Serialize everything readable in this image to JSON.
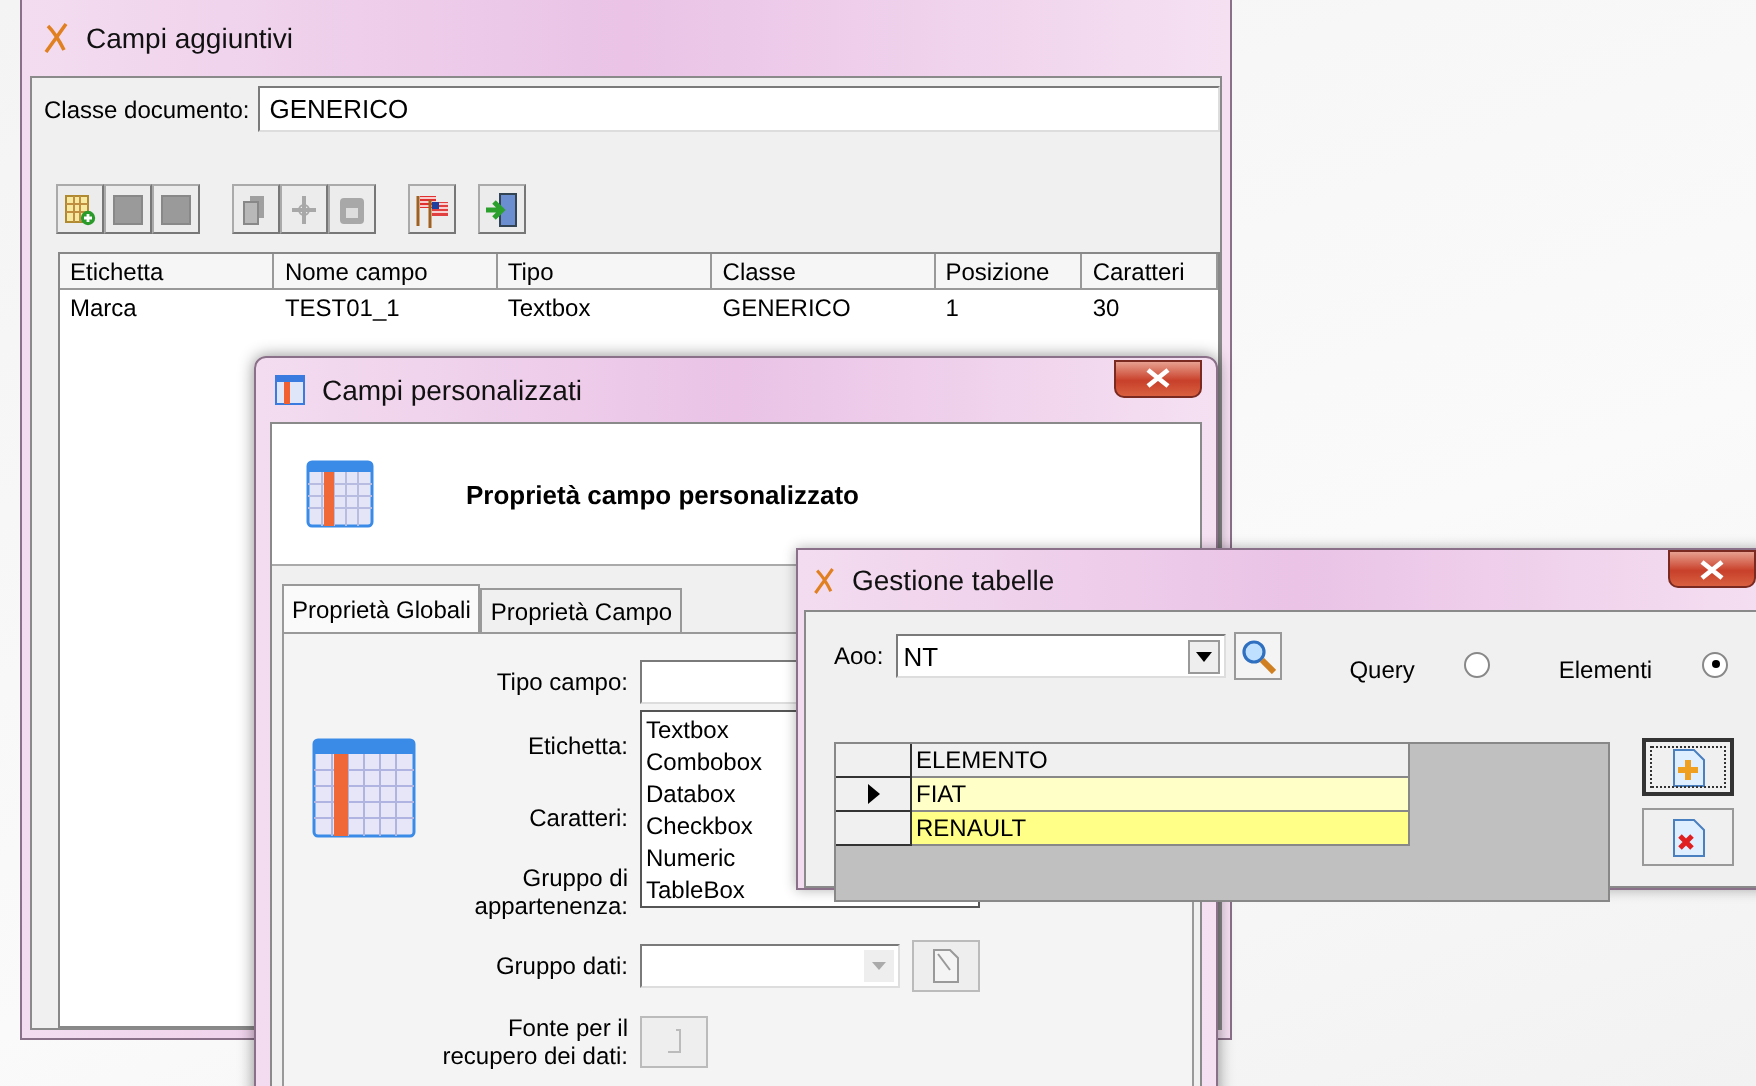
{
  "campi_aggiuntivi": {
    "title": "Campi aggiuntivi",
    "classe_label": "Classe documento:",
    "classe_value": "GENERICO",
    "toolbar": [
      {
        "kind": "add",
        "disabled": false
      },
      {
        "kind": "blank",
        "disabled": true
      },
      {
        "kind": "blank",
        "disabled": true
      },
      {
        "kind": "copy",
        "disabled": true
      },
      {
        "kind": "cut",
        "disabled": true
      },
      {
        "kind": "paste",
        "disabled": true
      },
      {
        "kind": "flag",
        "disabled": false
      },
      {
        "kind": "exit",
        "disabled": false
      }
    ],
    "columns": [
      "Etichetta",
      "Nome campo",
      "Tipo",
      "Classe",
      "Posizione",
      "Caratteri"
    ],
    "rows": [
      [
        "Marca",
        "TEST01_1",
        "Textbox",
        "GENERICO",
        "1",
        "30"
      ]
    ]
  },
  "campi_personalizzati": {
    "title": "Campi personalizzati",
    "header": "Proprietà campo personalizzato",
    "tabs": [
      {
        "label": "Proprietà Globali",
        "selected": true
      },
      {
        "label": "Proprietà Campo",
        "selected": false
      }
    ],
    "tipo_campo_label": "Tipo campo:",
    "tipo_options": [
      "Textbox",
      "Combobox",
      "Databox",
      "Checkbox",
      "Numeric",
      "TableBox"
    ],
    "etichetta_label": "Etichetta:",
    "caratteri_label": "Caratteri:",
    "gruppo_label": "Gruppo di appartenenza:",
    "gruppo_dati_label": "Gruppo dati:",
    "fonte_label": "Fonte per il recupero dei dati:"
  },
  "gestione_tabelle": {
    "title": "Gestione tabelle",
    "aoo_label": "Aoo:",
    "aoo_value": "NT",
    "radios": [
      {
        "label": "Query",
        "selected": false
      },
      {
        "label": "Elementi",
        "selected": true
      }
    ],
    "grid_header": "ELEMENTO",
    "grid_rows": [
      {
        "value": "FIAT",
        "selected": true
      },
      {
        "value": "RENAULT",
        "selected": false
      }
    ]
  }
}
